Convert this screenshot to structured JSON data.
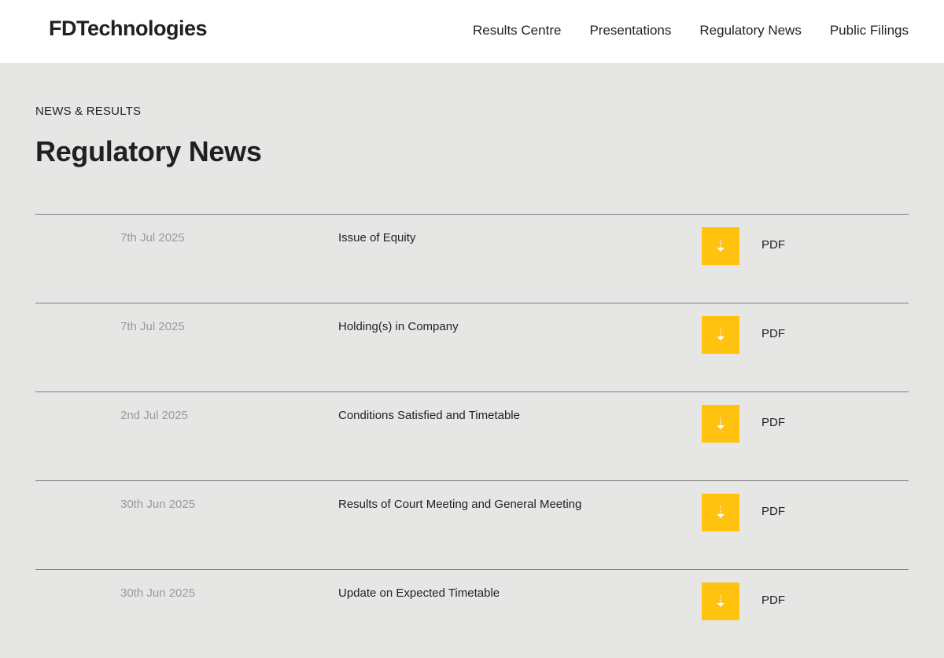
{
  "header": {
    "logo": "FDTechnologies",
    "nav": [
      {
        "label": "Results Centre"
      },
      {
        "label": "Presentations"
      },
      {
        "label": "Regulatory News"
      },
      {
        "label": "Public Filings"
      }
    ]
  },
  "page": {
    "eyebrow": "NEWS & RESULTS",
    "title": "Regulatory News"
  },
  "news": [
    {
      "date": "7th Jul 2025",
      "title": "Issue of Equity",
      "file_label": "PDF"
    },
    {
      "date": "7th Jul 2025",
      "title": "Holding(s) in Company",
      "file_label": "PDF"
    },
    {
      "date": "2nd Jul 2025",
      "title": "Conditions Satisfied and Timetable",
      "file_label": "PDF"
    },
    {
      "date": "30th Jun 2025",
      "title": "Results of Court Meeting and General Meeting",
      "file_label": "PDF"
    },
    {
      "date": "30th Jun 2025",
      "title": "Update on Expected Timetable",
      "file_label": "PDF"
    }
  ],
  "colors": {
    "background": "#e6e6e5",
    "header_background": "#ffffff",
    "accent_button": "#ffc20e",
    "date_text": "#9a9a9a",
    "divider": "#7d7d7d"
  },
  "icons": {
    "download": "download-arrow-icon"
  }
}
